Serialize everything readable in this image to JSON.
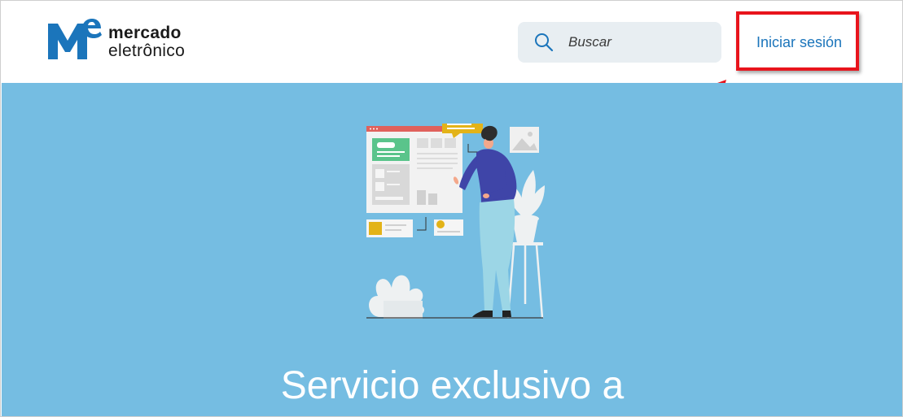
{
  "header": {
    "logo": {
      "mark_letters": "Me",
      "line1": "mercado",
      "line2": "eletrônico",
      "colors": {
        "mark": "#1b75bb",
        "text": "#1a1a1a"
      }
    },
    "search": {
      "placeholder": "Buscar",
      "icon": "search-icon"
    },
    "login_label": "Iniciar sesión"
  },
  "annotation": {
    "highlight_color": "#e8141c",
    "arrow_icon": "arrow-up-right-icon"
  },
  "hero": {
    "background": "#75bde2",
    "title": "Servicio exclusivo a",
    "illustration": "person-presenting-dashboard"
  }
}
